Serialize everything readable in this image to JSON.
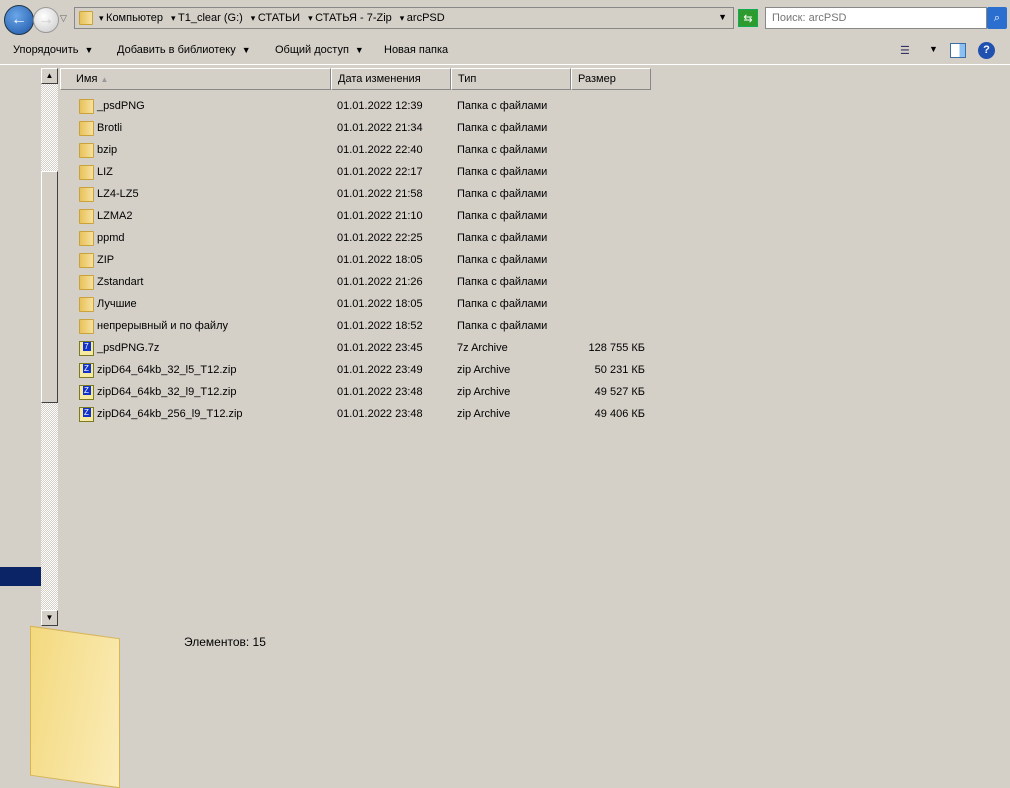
{
  "nav": {
    "back": "back",
    "forward": "forward"
  },
  "address": {
    "crumbs": [
      "Компьютер",
      "T1_clear (G:)",
      "СТАТЬИ",
      "СТАТЬЯ - 7-Zip",
      "arcPSD"
    ]
  },
  "search": {
    "placeholder": "Поиск: arcPSD"
  },
  "toolbar": {
    "organize": "Упорядочить",
    "add_library": "Добавить в библиотеку",
    "share": "Общий доступ",
    "new_folder": "Новая папка"
  },
  "columns": {
    "name": "Имя",
    "date": "Дата изменения",
    "type": "Тип",
    "size": "Размер"
  },
  "files": [
    {
      "name": "_psdPNG",
      "date": "01.01.2022 12:39",
      "type": "Папка с файлами",
      "size": "",
      "kind": "folder"
    },
    {
      "name": "Brotli",
      "date": "01.01.2022 21:34",
      "type": "Папка с файлами",
      "size": "",
      "kind": "folder"
    },
    {
      "name": "bzip",
      "date": "01.01.2022 22:40",
      "type": "Папка с файлами",
      "size": "",
      "kind": "folder"
    },
    {
      "name": "LIZ",
      "date": "01.01.2022 22:17",
      "type": "Папка с файлами",
      "size": "",
      "kind": "folder"
    },
    {
      "name": "LZ4-LZ5",
      "date": "01.01.2022 21:58",
      "type": "Папка с файлами",
      "size": "",
      "kind": "folder"
    },
    {
      "name": "LZMA2",
      "date": "01.01.2022 21:10",
      "type": "Папка с файлами",
      "size": "",
      "kind": "folder"
    },
    {
      "name": "ppmd",
      "date": "01.01.2022 22:25",
      "type": "Папка с файлами",
      "size": "",
      "kind": "folder"
    },
    {
      "name": "ZIP",
      "date": "01.01.2022 18:05",
      "type": "Папка с файлами",
      "size": "",
      "kind": "folder"
    },
    {
      "name": "Zstandart",
      "date": "01.01.2022 21:26",
      "type": "Папка с файлами",
      "size": "",
      "kind": "folder"
    },
    {
      "name": "Лучшие",
      "date": "01.01.2022 18:05",
      "type": "Папка с файлами",
      "size": "",
      "kind": "folder"
    },
    {
      "name": "непрерывный и по файлу",
      "date": "01.01.2022 18:52",
      "type": "Папка с файлами",
      "size": "",
      "kind": "folder"
    },
    {
      "name": "_psdPNG.7z",
      "date": "01.01.2022 23:45",
      "type": "7z Archive",
      "size": "128 755 КБ",
      "kind": "7z"
    },
    {
      "name": "zipD64_64kb_32_l5_T12.zip",
      "date": "01.01.2022 23:49",
      "type": "zip Archive",
      "size": "50 231 КБ",
      "kind": "zip"
    },
    {
      "name": "zipD64_64kb_32_l9_T12.zip",
      "date": "01.01.2022 23:48",
      "type": "zip Archive",
      "size": "49 527 КБ",
      "kind": "zip"
    },
    {
      "name": "zipD64_64kb_256_l9_T12.zip",
      "date": "01.01.2022 23:48",
      "type": "zip Archive",
      "size": "49 406 КБ",
      "kind": "zip"
    }
  ],
  "status": {
    "items": "Элементов: 15"
  }
}
